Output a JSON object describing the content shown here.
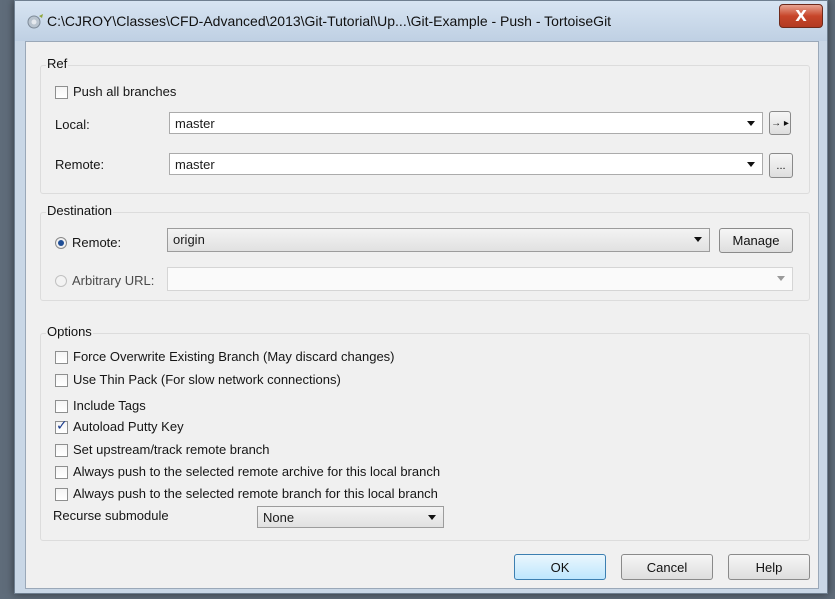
{
  "window": {
    "title": "C:\\CJROY\\Classes\\CFD-Advanced\\2013\\Git-Tutorial\\Up...\\Git-Example - Push - TortoiseGit",
    "close_label": "X"
  },
  "ref": {
    "group_label": "Ref",
    "push_all_branches": {
      "label": "Push all branches",
      "checked": false
    },
    "local": {
      "label": "Local:",
      "value": "master",
      "more_button": "→ ▸"
    },
    "remote": {
      "label": "Remote:",
      "value": "master",
      "browse_button": "..."
    }
  },
  "destination": {
    "group_label": "Destination",
    "remote": {
      "label": "Remote:",
      "value": "origin",
      "selected": true
    },
    "manage_button": "Manage",
    "arbitrary_url": {
      "label": "Arbitrary URL:",
      "value": "",
      "selected": false
    }
  },
  "options": {
    "group_label": "Options",
    "checkboxes": [
      {
        "label": "Force Overwrite Existing Branch (May discard changes)",
        "checked": false
      },
      {
        "label": "Use Thin Pack (For slow network connections)",
        "checked": false
      },
      {
        "label": "Include Tags",
        "checked": false
      },
      {
        "label": "Autoload Putty Key",
        "checked": true
      },
      {
        "label": "Set upstream/track remote branch",
        "checked": false
      },
      {
        "label": "Always push to the selected remote archive for this local branch",
        "checked": false
      },
      {
        "label": "Always push to the selected remote branch for this local branch",
        "checked": false
      }
    ],
    "recurse_submodule": {
      "label": "Recurse submodule",
      "value": "None"
    }
  },
  "buttons": {
    "ok": "OK",
    "cancel": "Cancel",
    "help": "Help"
  },
  "colors": {
    "title_bar": "#c9d7e6",
    "close_button": "#c7462a",
    "default_button": "#bee6fd"
  }
}
